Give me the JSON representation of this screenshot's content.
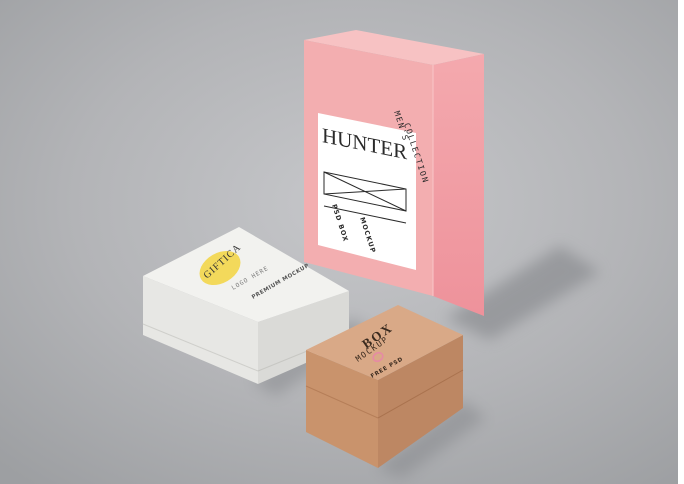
{
  "scene": {
    "background_color": "#a3a5a8",
    "frame_color": "#ffffff"
  },
  "pink_box": {
    "color_front": "#f3aeb0",
    "color_side": "#f19da3",
    "color_top": "#f7c2c3",
    "label": {
      "title": "HUNTER",
      "subtitle_line1": "MEN'S",
      "subtitle_line2": "COLLECTION",
      "footer_left": "PSD BOX",
      "footer_right": "MOCKUP"
    }
  },
  "white_box": {
    "color_top": "#f2f2ef",
    "color_front": "#e7e7e4",
    "color_side": "#dadad7",
    "badge_color": "#f3d95b",
    "brand": "GIFTICA",
    "tagline": "LOGO HERE",
    "caption": "PREMIUM MOCKUP"
  },
  "kraft_box": {
    "color_top": "#d9a987",
    "color_front": "#c9936c",
    "color_side": "#bd8763",
    "ring_color": "#e68aa4",
    "title": "BOX",
    "subtitle": "MOCKUP",
    "caption": "FREE PSD"
  }
}
